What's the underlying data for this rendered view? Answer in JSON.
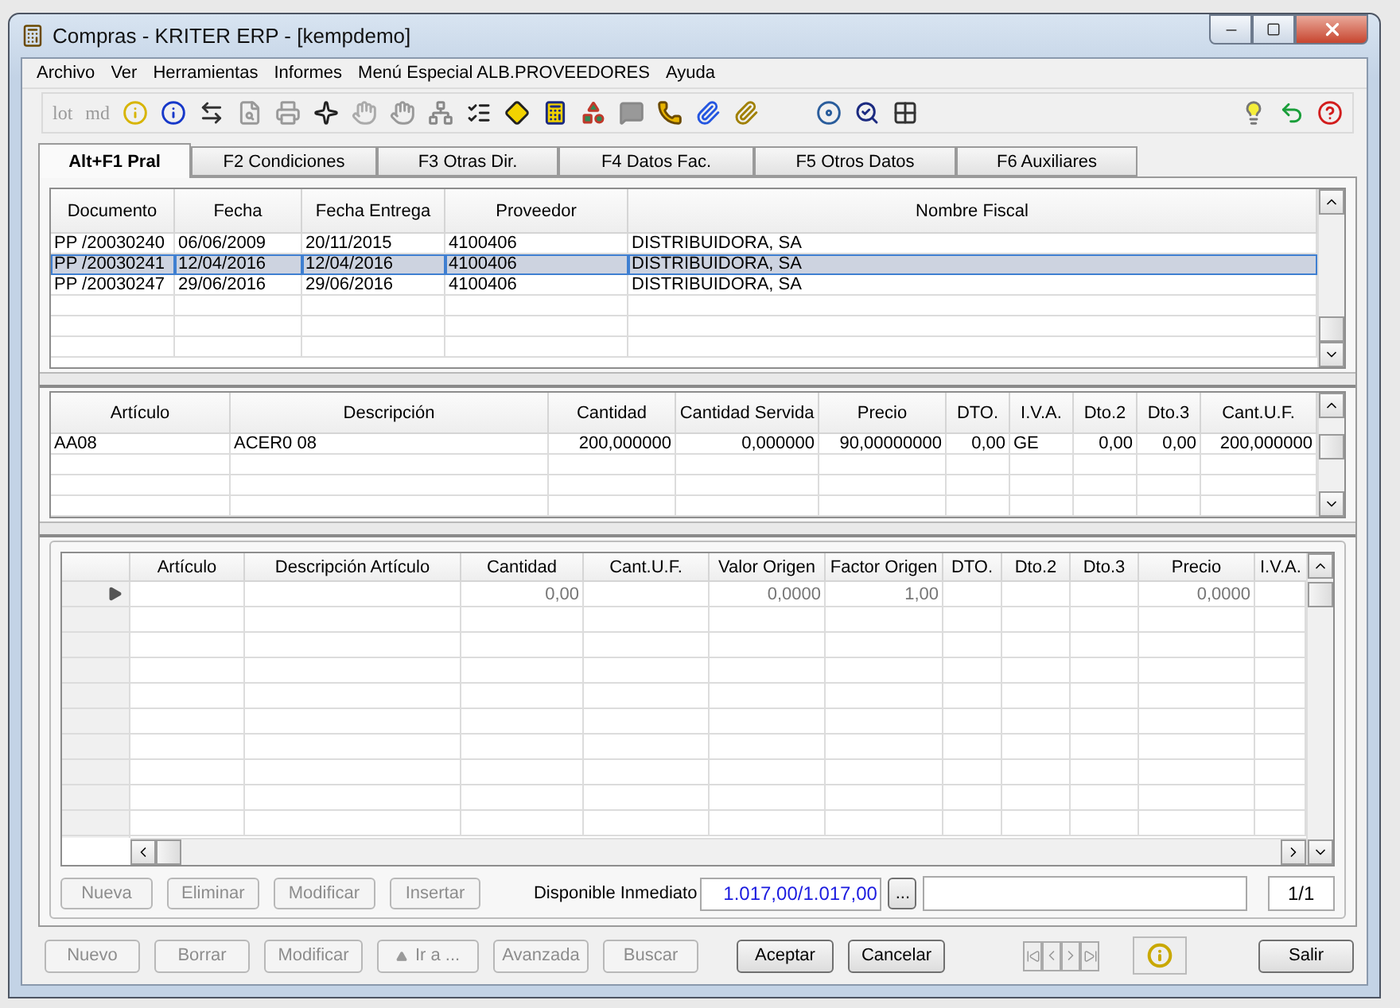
{
  "window": {
    "title": "Compras - KRITER ERP - [kempdemo]"
  },
  "menu": [
    "Archivo",
    "Ver",
    "Herramientas",
    "Informes",
    "Menú Especial ALB.PROVEEDORES",
    "Ayuda"
  ],
  "toolbar": {
    "text_buttons": [
      {
        "label": "lot",
        "disabled": true
      },
      {
        "label": "md",
        "disabled": true
      }
    ]
  },
  "tabs": [
    {
      "label": "Alt+F1 Pral",
      "selected": true
    },
    {
      "label": "F2 Condiciones",
      "selected": false
    },
    {
      "label": "F3 Otras Dir.",
      "selected": false
    },
    {
      "label": "F4 Datos Fac.",
      "selected": false
    },
    {
      "label": "F5 Otros Datos",
      "selected": false
    },
    {
      "label": "F6 Auxiliares",
      "selected": false
    }
  ],
  "orders": {
    "columns": [
      "Documento",
      "Fecha",
      "Fecha Entrega",
      "Proveedor",
      "Nombre Fiscal"
    ],
    "rows": [
      {
        "cells": [
          "PP /20030240",
          "06/06/2009",
          "20/11/2015",
          "4100406",
          "DISTRIBUIDORA, SA"
        ],
        "selected": false
      },
      {
        "cells": [
          "PP /20030241",
          "12/04/2016",
          "12/04/2016",
          "4100406",
          "DISTRIBUIDORA, SA"
        ],
        "selected": true
      },
      {
        "cells": [
          "PP /20030247",
          "29/06/2016",
          "29/06/2016",
          "4100406",
          "DISTRIBUIDORA, SA"
        ],
        "selected": false
      }
    ]
  },
  "lines": {
    "columns": [
      "Artículo",
      "Descripción",
      "Cantidad",
      "Cantidad Servida",
      "Precio",
      "DTO.",
      "I.V.A.",
      "Dto.2",
      "Dto.3",
      "Cant.U.F."
    ],
    "rows": [
      {
        "cells": [
          "AA08",
          "ACER0 08",
          "200,000000",
          "0,000000",
          "90,00000000",
          "0,00",
          "GE",
          "0,00",
          "0,00",
          "200,000000"
        ],
        "selected": false
      }
    ]
  },
  "entry": {
    "columns": [
      "Artículo",
      "Descripción Artículo",
      "Cantidad",
      "Cant.U.F.",
      "Valor Origen",
      "Factor Origen",
      "DTO.",
      "Dto.2",
      "Dto.3",
      "Precio",
      "I.V.A."
    ],
    "rows": [
      {
        "cells": [
          "",
          "",
          "0,00",
          "",
          "0,0000",
          "1,00",
          "",
          "",
          "",
          "0,0000",
          ""
        ],
        "current": true
      }
    ]
  },
  "entry_buttons": [
    {
      "label": "Nueva",
      "disabled": true
    },
    {
      "label": "Eliminar",
      "disabled": true
    },
    {
      "label": "Modificar",
      "disabled": true
    },
    {
      "label": "Insertar",
      "disabled": true
    }
  ],
  "availability": {
    "label": "Disponible Inmediato",
    "value": "1.017,00/1.017,00",
    "more": "...",
    "page": "1/1"
  },
  "footer_buttons": [
    {
      "label": "Nuevo",
      "disabled": true
    },
    {
      "label": "Borrar",
      "disabled": true
    },
    {
      "label": "Modificar",
      "disabled": true
    },
    {
      "label": "Ir a ...",
      "disabled": true,
      "kind": "goto"
    },
    {
      "label": "Avanzada",
      "disabled": true
    },
    {
      "label": "Buscar",
      "disabled": true
    }
  ],
  "actions": [
    {
      "label": "Aceptar",
      "disabled": false
    },
    {
      "label": "Cancelar",
      "disabled": false
    }
  ],
  "exit": {
    "label": "Salir"
  }
}
